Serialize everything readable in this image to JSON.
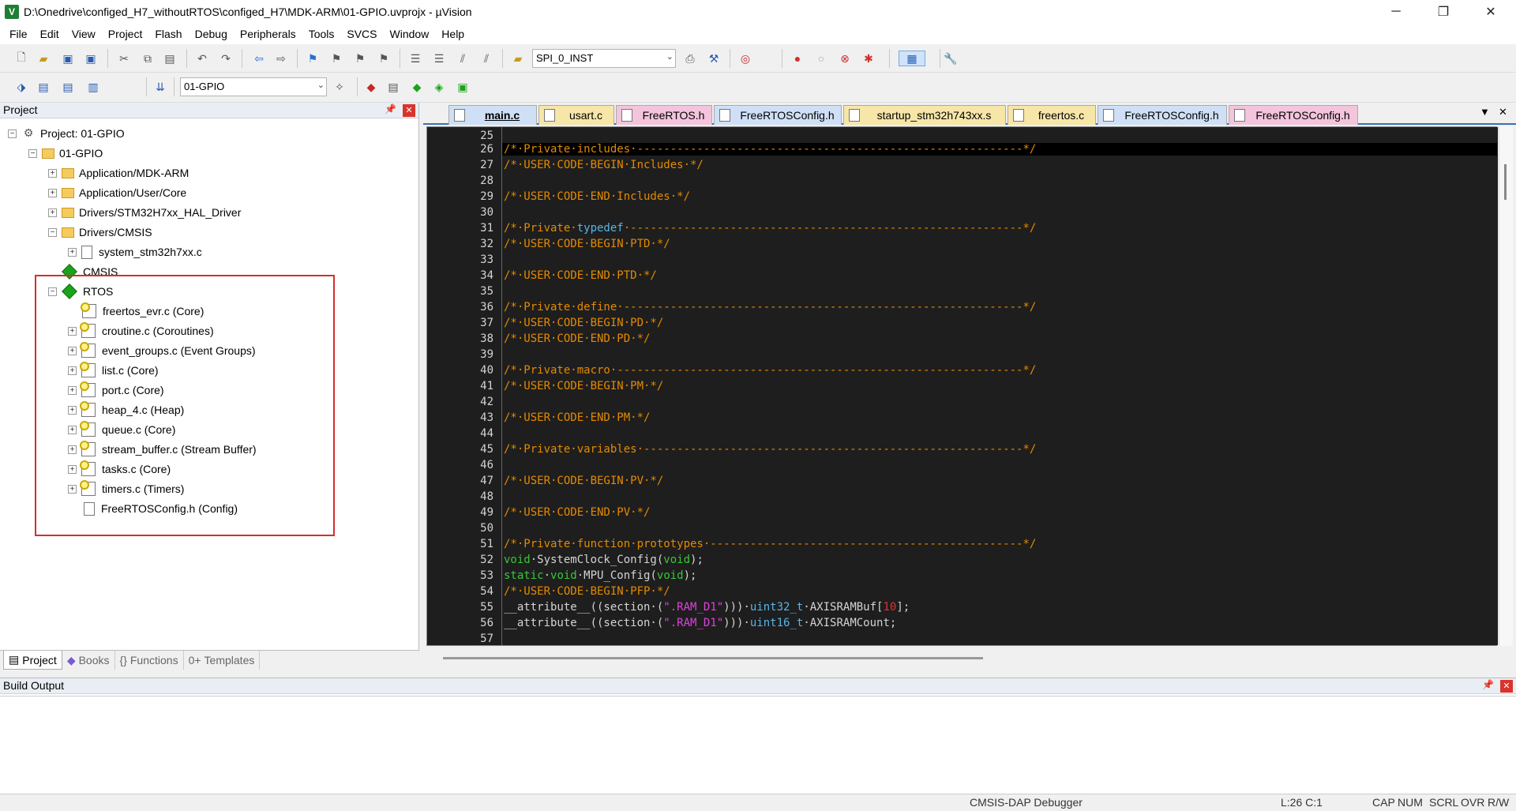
{
  "window": {
    "title": "D:\\Onedrive\\configed_H7_withoutRTOS\\configed_H7\\MDK-ARM\\01-GPIO.uvprojx - µVision",
    "app_icon": "V"
  },
  "window_controls": {
    "minimize": "─",
    "restore": "❐",
    "close": "✕"
  },
  "menu": [
    "File",
    "Edit",
    "View",
    "Project",
    "Flash",
    "Debug",
    "Peripherals",
    "Tools",
    "SVCS",
    "Window",
    "Help"
  ],
  "toolbar1": {
    "combo_value": "SPI_0_INST"
  },
  "toolbar2": {
    "target_value": "01-GPIO"
  },
  "project_pane": {
    "title": "Project",
    "pin": "📌",
    "close": "✕",
    "tree": [
      {
        "label": "Project: 01-GPIO"
      },
      {
        "label": "01-GPIO"
      },
      {
        "label": "Application/MDK-ARM"
      },
      {
        "label": "Application/User/Core"
      },
      {
        "label": "Drivers/STM32H7xx_HAL_Driver"
      },
      {
        "label": "Drivers/CMSIS"
      },
      {
        "label": "system_stm32h7xx.c"
      },
      {
        "label": "CMSIS"
      },
      {
        "label": "RTOS"
      },
      {
        "label": "freertos_evr.c (Core)"
      },
      {
        "label": "croutine.c (Coroutines)"
      },
      {
        "label": "event_groups.c (Event Groups)"
      },
      {
        "label": "list.c (Core)"
      },
      {
        "label": "port.c (Core)"
      },
      {
        "label": "heap_4.c (Heap)"
      },
      {
        "label": "queue.c (Core)"
      },
      {
        "label": "stream_buffer.c (Stream Buffer)"
      },
      {
        "label": "tasks.c (Core)"
      },
      {
        "label": "timers.c (Timers)"
      },
      {
        "label": "FreeRTOSConfig.h (Config)"
      }
    ],
    "bottom_tabs": [
      "Project",
      "Books",
      "Functions",
      "Templates"
    ],
    "bottom_tab_icons": [
      "▤",
      "◆",
      "{}",
      "0+"
    ]
  },
  "editor": {
    "tabs": [
      "main.c",
      "usart.c",
      "FreeRTOS.h",
      "FreeRTOSConfig.h",
      "startup_stm32h743xx.s",
      "freertos.c",
      "FreeRTOSConfig.h",
      "FreeRTOSConfig.h"
    ],
    "tab_colors": [
      "#cfe0f6",
      "#f6e6a8",
      "#f3c4dc",
      "#cfe0f6",
      "#f6e6a8",
      "#f6e6a8",
      "#cfe0f6",
      "#f3c4dc"
    ],
    "lines": [
      "25",
      "26",
      "27",
      "28",
      "29",
      "30",
      "31",
      "32",
      "33",
      "34",
      "35",
      "36",
      "37",
      "38",
      "39",
      "40",
      "41",
      "42",
      "43",
      "44",
      "45",
      "46",
      "47",
      "48",
      "49",
      "50",
      "51",
      "52",
      "53",
      "54",
      "55",
      "56",
      "57"
    ]
  },
  "build_output": {
    "title": "Build Output"
  },
  "status": {
    "debugger": "CMSIS-DAP Debugger",
    "position": "L:26 C:1",
    "caps": "CAP",
    "num": "NUM",
    "scrl": "SCRL",
    "ovr": "OVR",
    "rw": "R/W"
  },
  "colors": {
    "comment": "#e48a00",
    "keyword": "#5ab4e5",
    "type_green": "#39c639",
    "string": "#e040e0",
    "number": "#e03030",
    "rtos_highlight": "#d32f2f",
    "editor_bg": "#1e1e1e"
  }
}
